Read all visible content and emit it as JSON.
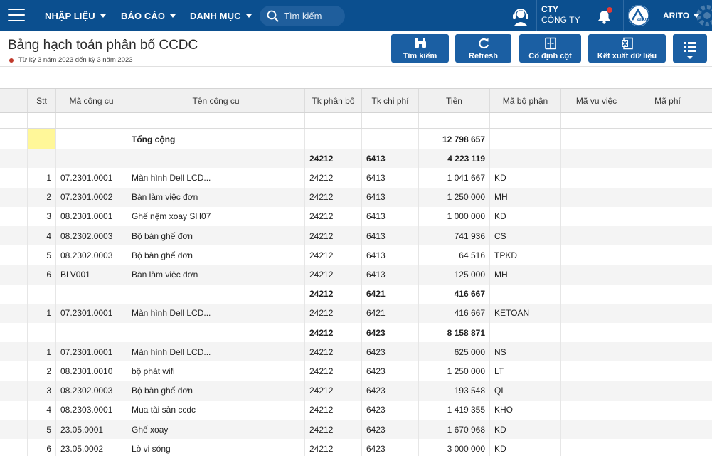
{
  "nav": {
    "menus": [
      {
        "label": "NHẬP LIỆU"
      },
      {
        "label": "BÁO CÁO"
      },
      {
        "label": "DANH MỤC"
      }
    ],
    "search_placeholder": "Tìm kiếm",
    "company_line1": "CTY",
    "company_line2": "CÔNG TY",
    "user": "ARITO",
    "avatar_text": "arito",
    "icons": {
      "menu": "hamburger-icon",
      "support": "headset-icon",
      "notify": "bell-icon",
      "settings": "gear-icon"
    },
    "colors": {
      "bar": "#0b4f8f",
      "notify_dot": "#e53935"
    }
  },
  "header": {
    "title": "Bảng hạch toán phân bổ CCDC",
    "subtitle": "Từ kỳ 3 năm 2023 đến kỳ 3 năm 2023"
  },
  "toolbar": {
    "search": "Tìm kiếm",
    "refresh": "Refresh",
    "pin": "Cố định cột",
    "export": "Kết xuất dữ liệu",
    "more_icon": "list-menu-icon",
    "color": "#1b5fa3"
  },
  "table": {
    "columns": [
      "Stt",
      "Mã công cụ",
      "Tên công cụ",
      "Tk phân bổ",
      "Tk chi phí",
      "Tiền",
      "Mã bộ phận",
      "Mã vụ việc",
      "Mã phí"
    ],
    "rows": [
      {
        "stt": "",
        "ma": "",
        "ten": "Tổng cộng",
        "tkpb": "",
        "tkcp": "",
        "tien": "12 798 657",
        "bp": "",
        "kind": "total"
      },
      {
        "stt": "",
        "ma": "",
        "ten": "",
        "tkpb": "24212",
        "tkcp": "6413",
        "tien": "4 223 119",
        "bp": "",
        "kind": "group"
      },
      {
        "stt": "1",
        "ma": "07.2301.0001",
        "ten": "Màn hình Dell LCD...",
        "tkpb": "24212",
        "tkcp": "6413",
        "tien": "1 041 667",
        "bp": "KD",
        "kind": "item"
      },
      {
        "stt": "2",
        "ma": "07.2301.0002",
        "ten": "Bàn làm việc đơn",
        "tkpb": "24212",
        "tkcp": "6413",
        "tien": "1 250 000",
        "bp": "MH",
        "kind": "item"
      },
      {
        "stt": "3",
        "ma": "08.2301.0001",
        "ten": "Ghế nệm xoay SH07",
        "tkpb": "24212",
        "tkcp": "6413",
        "tien": "1 000 000",
        "bp": "KD",
        "kind": "item"
      },
      {
        "stt": "4",
        "ma": "08.2302.0003",
        "ten": "Bộ bàn ghế đơn",
        "tkpb": "24212",
        "tkcp": "6413",
        "tien": "741 936",
        "bp": "CS",
        "kind": "item"
      },
      {
        "stt": "5",
        "ma": "08.2302.0003",
        "ten": "Bộ bàn ghế đơn",
        "tkpb": "24212",
        "tkcp": "6413",
        "tien": "64 516",
        "bp": "TPKD",
        "kind": "item"
      },
      {
        "stt": "6",
        "ma": "BLV001",
        "ten": "Bàn làm việc đơn",
        "tkpb": "24212",
        "tkcp": "6413",
        "tien": "125 000",
        "bp": "MH",
        "kind": "item"
      },
      {
        "stt": "",
        "ma": "",
        "ten": "",
        "tkpb": "24212",
        "tkcp": "6421",
        "tien": "416 667",
        "bp": "",
        "kind": "group"
      },
      {
        "stt": "1",
        "ma": "07.2301.0001",
        "ten": "Màn hình Dell LCD...",
        "tkpb": "24212",
        "tkcp": "6421",
        "tien": "416 667",
        "bp": "KETOAN",
        "kind": "item"
      },
      {
        "stt": "",
        "ma": "",
        "ten": "",
        "tkpb": "24212",
        "tkcp": "6423",
        "tien": "8 158 871",
        "bp": "",
        "kind": "group"
      },
      {
        "stt": "1",
        "ma": "07.2301.0001",
        "ten": "Màn hình Dell LCD...",
        "tkpb": "24212",
        "tkcp": "6423",
        "tien": "625 000",
        "bp": "NS",
        "kind": "item"
      },
      {
        "stt": "2",
        "ma": "08.2301.0010",
        "ten": "bộ phát wifi",
        "tkpb": "24212",
        "tkcp": "6423",
        "tien": "1 250 000",
        "bp": "LT",
        "kind": "item"
      },
      {
        "stt": "3",
        "ma": "08.2302.0003",
        "ten": "Bộ bàn ghế đơn",
        "tkpb": "24212",
        "tkcp": "6423",
        "tien": "193 548",
        "bp": "QL",
        "kind": "item"
      },
      {
        "stt": "4",
        "ma": "08.2303.0001",
        "ten": "Mua tài sản ccdc",
        "tkpb": "24212",
        "tkcp": "6423",
        "tien": "1 419 355",
        "bp": "KHO",
        "kind": "item"
      },
      {
        "stt": "5",
        "ma": "23.05.0001",
        "ten": "Ghế xoay",
        "tkpb": "24212",
        "tkcp": "6423",
        "tien": "1 670 968",
        "bp": "KD",
        "kind": "item"
      },
      {
        "stt": "6",
        "ma": "23.05.0002",
        "ten": "Lò vi sóng",
        "tkpb": "24212",
        "tkcp": "6423",
        "tien": "3 000 000",
        "bp": "KD",
        "kind": "item"
      }
    ]
  }
}
